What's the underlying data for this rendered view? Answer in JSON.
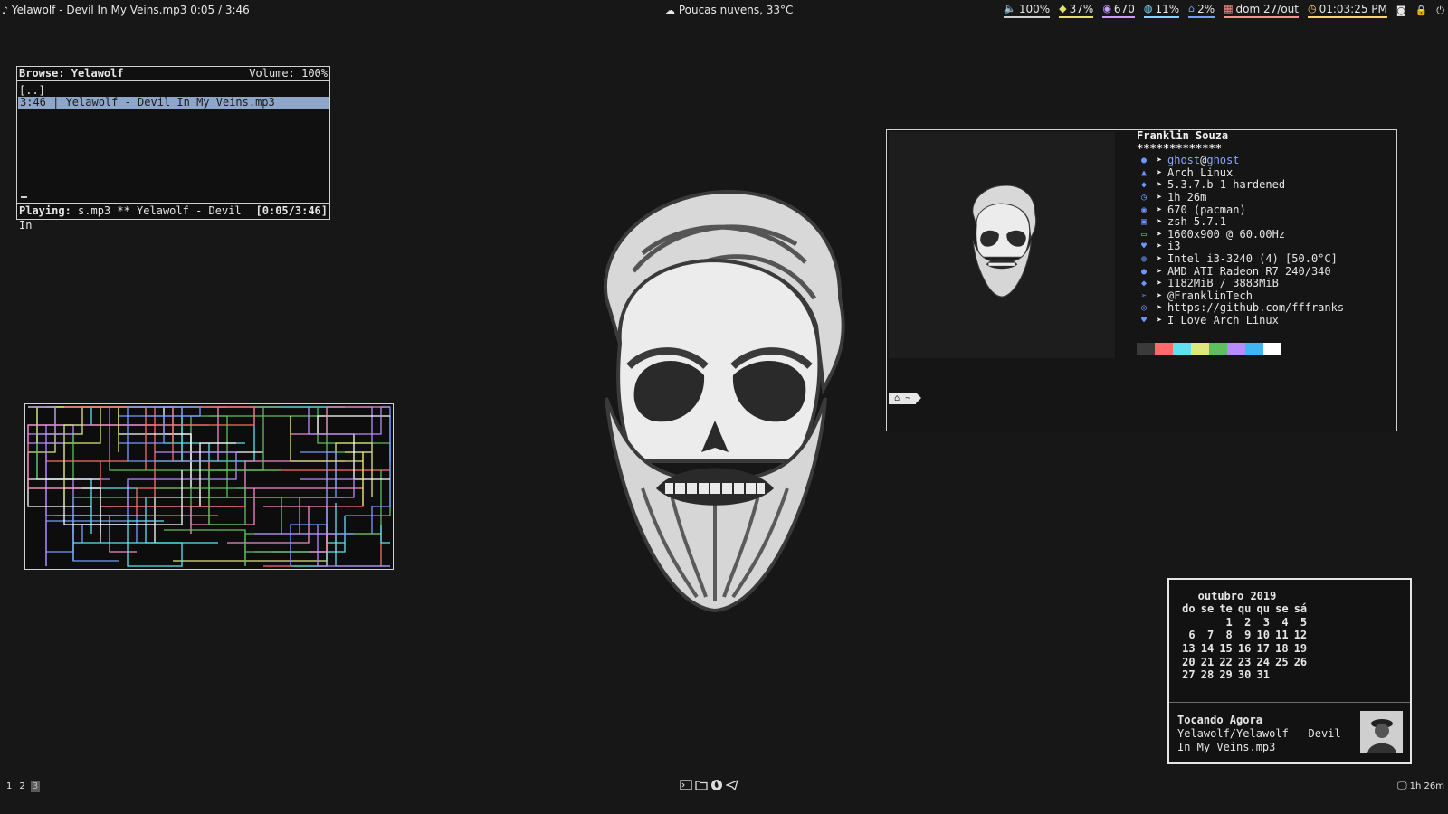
{
  "topbar": {
    "now_playing": "Yelawolf - Devil In My Veins.mp3 0:05 / 3:46",
    "weather": "Poucas nuvens, 33°C",
    "modules": [
      {
        "name": "volume",
        "value": "100%",
        "color": "#cfcfcf",
        "icon": "speaker-icon"
      },
      {
        "name": "battery",
        "value": "37%",
        "color": "#e5e06b",
        "icon": "tag-icon"
      },
      {
        "name": "packages",
        "value": "670",
        "color": "#c89cff",
        "icon": "ghost-icon"
      },
      {
        "name": "cpu",
        "value": "11%",
        "color": "#7fd6ff",
        "icon": "cpu-icon"
      },
      {
        "name": "disk",
        "value": "2%",
        "color": "#7a9cff",
        "icon": "home-icon"
      },
      {
        "name": "date",
        "value": "dom 27/out",
        "color": "#ff8e8e",
        "icon": "calendar-icon"
      },
      {
        "name": "clock",
        "value": "01:03:25 PM",
        "color": "#ffd36b",
        "icon": "clock-icon"
      }
    ]
  },
  "cmus": {
    "browse_label": "Browse: Yelawolf",
    "volume_label": "Volume: 100%",
    "rows": [
      "[..]",
      "3:46 | Yelawolf - Devil In My Veins.mp3"
    ],
    "status_label": "Playing:",
    "status_text": " s.mp3 ** Yelawolf - Devil In",
    "status_time": "[0:05/3:46]",
    "progress": 0.02
  },
  "neofetch": {
    "username": "Franklin Souza",
    "stars": "*************",
    "user": "ghost",
    "at": "@",
    "host": "ghost",
    "lines": [
      {
        "icon": "distro-icon",
        "text": "Arch Linux"
      },
      {
        "icon": "kernel-icon",
        "text": "5.3.7.b-1-hardened"
      },
      {
        "icon": "uptime-icon",
        "text": "1h 26m"
      },
      {
        "icon": "packages-icon",
        "text": "670 (pacman)"
      },
      {
        "icon": "shell-icon",
        "text": "zsh 5.7.1"
      },
      {
        "icon": "resolution-icon",
        "text": "1600x900 @ 60.00Hz"
      },
      {
        "icon": "wm-icon",
        "text": "i3"
      },
      {
        "icon": "cpu-icon",
        "text": "Intel i3-3240 (4) [50.0°C]"
      },
      {
        "icon": "gpu-icon",
        "text": "AMD ATI Radeon R7 240/340"
      },
      {
        "icon": "memory-icon",
        "text": "1182MiB / 3883MiB"
      },
      {
        "icon": "telegram-icon",
        "text": "@FranklinTech"
      },
      {
        "icon": "github-icon",
        "text": "https://github.com/fffranks"
      },
      {
        "icon": "heart-icon",
        "text": "I Love Arch Linux"
      }
    ],
    "colors": [
      "#3a3a3a",
      "#ff6b6b",
      "#5fe1f2",
      "#dfe87c",
      "#5fbf5f",
      "#b88bff",
      "#3fb7f5",
      "#ffffff"
    ],
    "prompt": "~"
  },
  "calendar": {
    "month": "outubro 2019",
    "weekdays": [
      "do",
      "se",
      "te",
      "qu",
      "qu",
      "se",
      "sá"
    ],
    "weeks": [
      [
        "",
        "",
        "1",
        "2",
        "3",
        "4",
        "5"
      ],
      [
        "6",
        "7",
        "8",
        "9",
        "10",
        "11",
        "12"
      ],
      [
        "13",
        "14",
        "15",
        "16",
        "17",
        "18",
        "19"
      ],
      [
        "20",
        "21",
        "22",
        "23",
        "24",
        "25",
        "26"
      ],
      [
        "27",
        "28",
        "29",
        "30",
        "31",
        "",
        ""
      ]
    ],
    "np_title": "Tocando Agora",
    "np_track": "Yelawolf/Yelawolf - Devil In My Veins.mp3"
  },
  "bottombar": {
    "workspaces": [
      "1",
      "2",
      "3"
    ],
    "active_workspace": "3",
    "uptime": "1h 26m",
    "dock": [
      "terminal-icon",
      "folder-icon",
      "firefox-icon",
      "telegram-icon"
    ]
  }
}
